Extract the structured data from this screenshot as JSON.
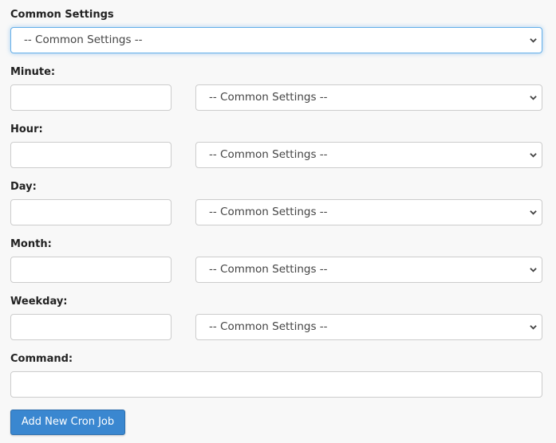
{
  "common_settings": {
    "label": "Common Settings",
    "selected": "-- Common Settings --"
  },
  "rows": [
    {
      "label": "Minute:",
      "value": "",
      "select": "-- Common Settings --"
    },
    {
      "label": "Hour:",
      "value": "",
      "select": "-- Common Settings --"
    },
    {
      "label": "Day:",
      "value": "",
      "select": "-- Common Settings --"
    },
    {
      "label": "Month:",
      "value": "",
      "select": "-- Common Settings --"
    },
    {
      "label": "Weekday:",
      "value": "",
      "select": "-- Common Settings --"
    }
  ],
  "command": {
    "label": "Command:",
    "value": ""
  },
  "submit_label": "Add New Cron Job"
}
